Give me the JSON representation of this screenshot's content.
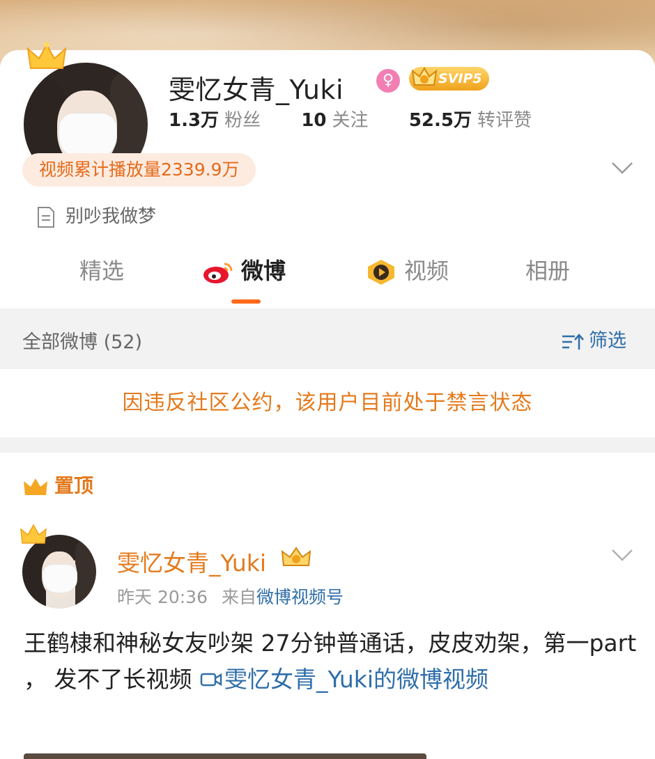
{
  "profile": {
    "username": "雯忆女青_Yuki",
    "gender_symbol": "♀",
    "vip_level": "SVIP5",
    "stats": [
      {
        "value": "1.3万",
        "label": "粉丝"
      },
      {
        "value": "10",
        "label": "关注"
      },
      {
        "value": "52.5万",
        "label": "转评赞"
      }
    ],
    "video_views_badge": "视频累计播放量2339.9万",
    "bio": "别吵我做梦"
  },
  "tabs": [
    {
      "label": "精选"
    },
    {
      "label": "微博"
    },
    {
      "label": "视频"
    },
    {
      "label": "相册"
    }
  ],
  "filter_bar": {
    "count_label": "全部微博 (52)",
    "filter_label": "筛选"
  },
  "ban_notice": "因违反社区公约，该用户目前处于禁言状态",
  "pinned_label": "置顶",
  "post": {
    "author": "雯忆女青_Yuki",
    "time": "昨天 20:36",
    "source_prefix": "来自",
    "source": "微博视频号",
    "text": "王鹤棣和神秘女友吵架 27分钟普通话，皮皮劝架，第一part ， 发不了长视频 ",
    "link_text": "雯忆女青_Yuki的微博视频"
  },
  "colors": {
    "accent_orange": "#e47a1c",
    "link_blue": "#2f6ea8",
    "tab_underline": "#ff6a1a"
  }
}
